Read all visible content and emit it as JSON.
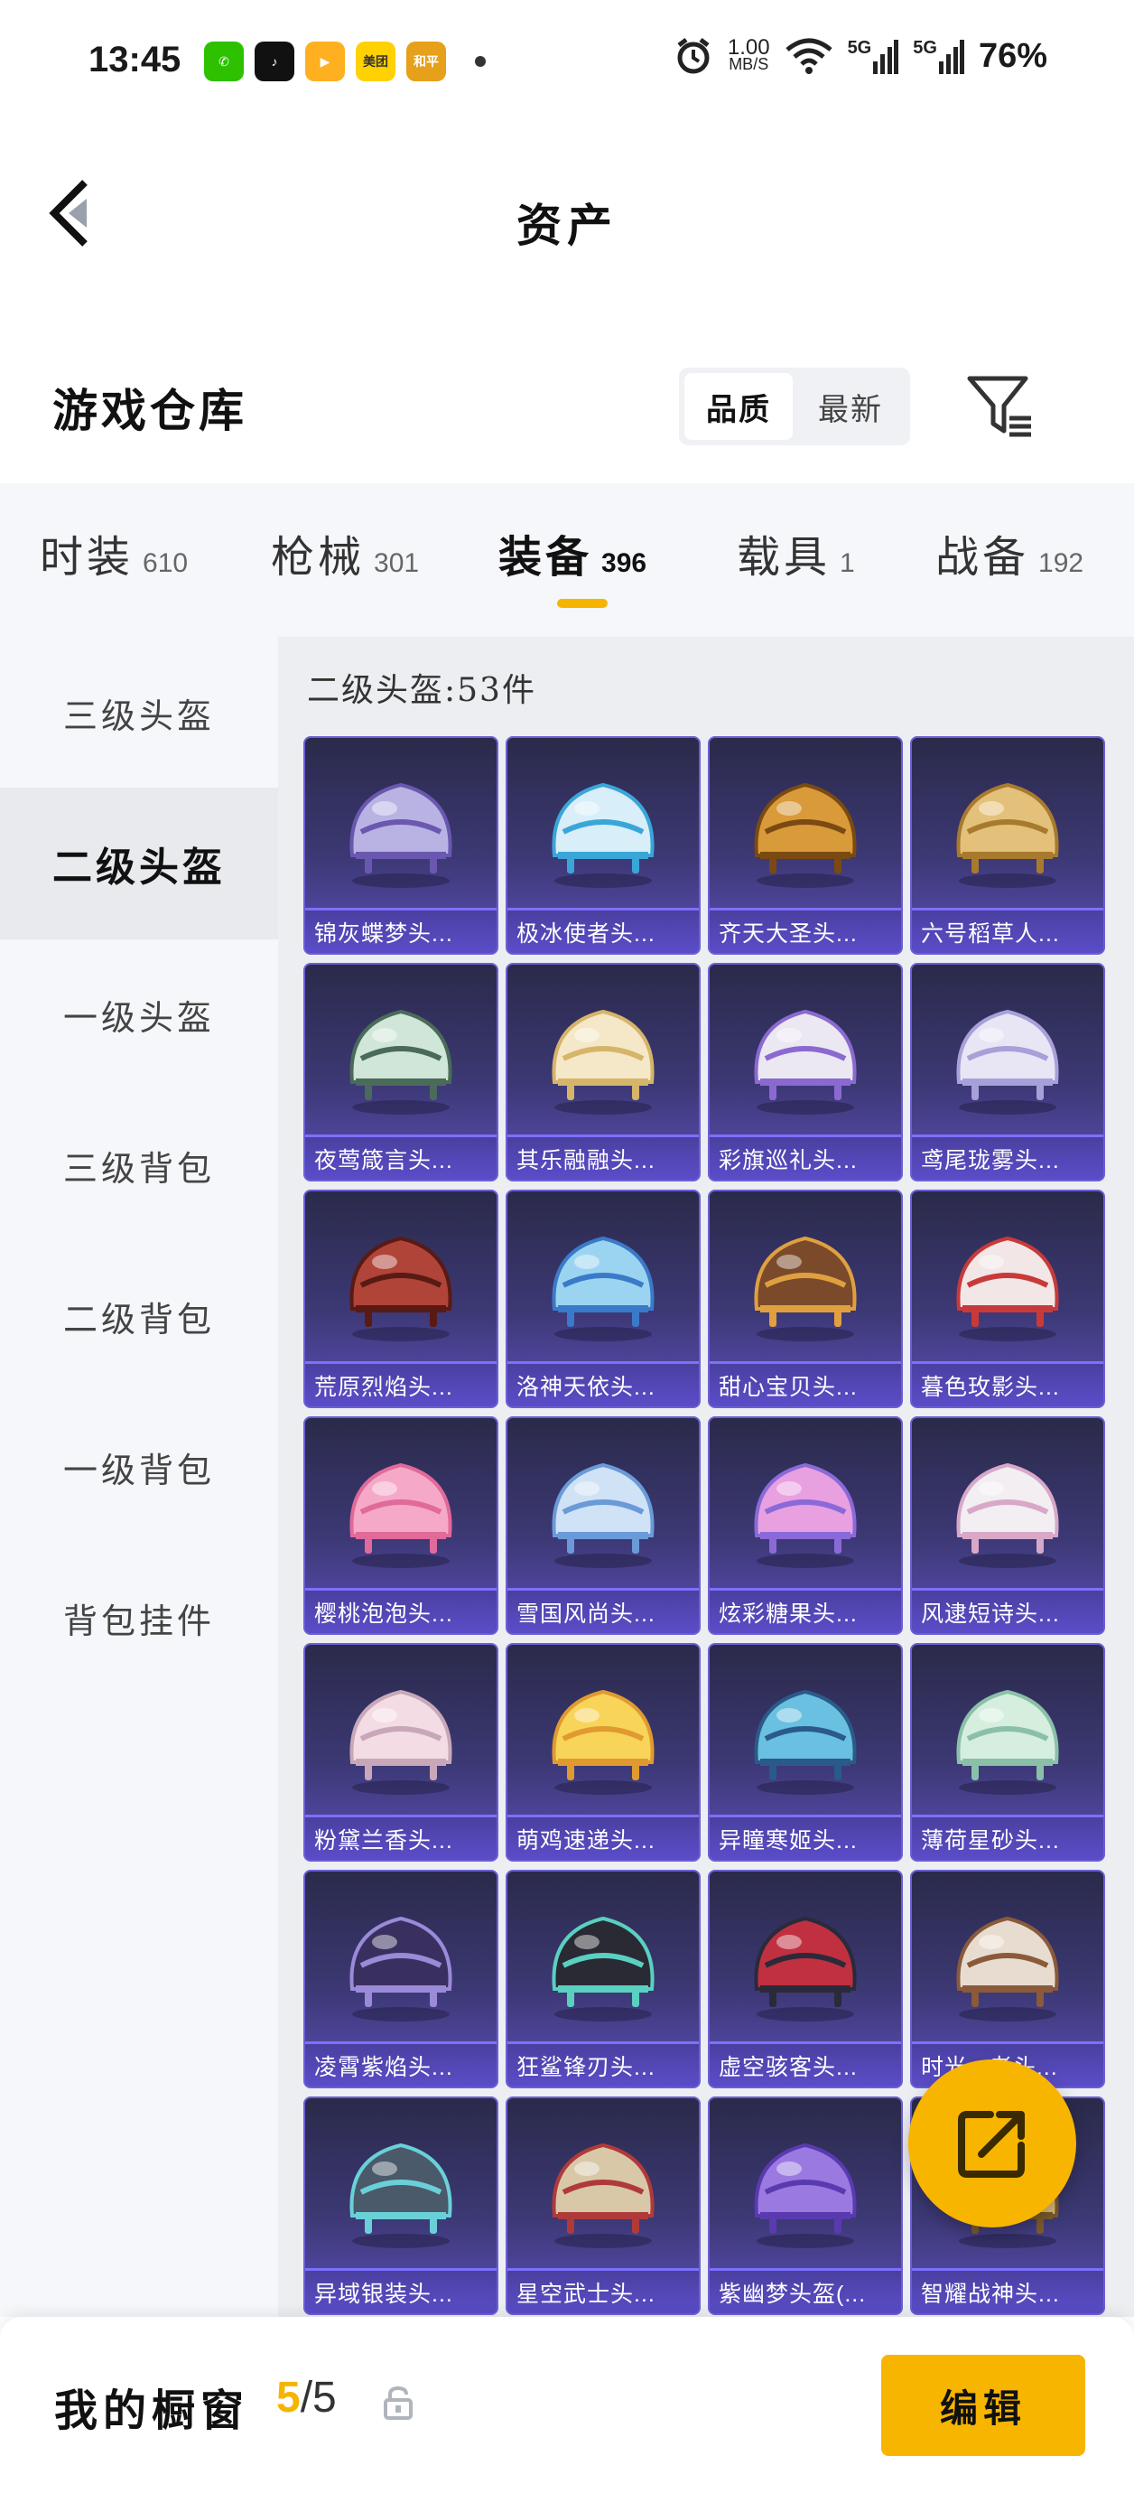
{
  "status_bar": {
    "time": "13:45",
    "apps": [
      {
        "name": "wechat-icon",
        "color": "#2dc100",
        "glyph": "✆"
      },
      {
        "name": "tiktok-icon",
        "color": "#111111",
        "glyph": "♪"
      },
      {
        "name": "video-app-icon",
        "color": "#ffb020",
        "glyph": "▶"
      },
      {
        "name": "meituan-icon",
        "color": "#ffd100",
        "glyph": "美团"
      },
      {
        "name": "game-app-icon",
        "color": "#e6a019",
        "glyph": "和平"
      }
    ],
    "net_speed_value": "1.00",
    "net_speed_unit": "MB/S",
    "network_1": "5G",
    "network_2": "5G",
    "battery": "76%"
  },
  "header": {
    "title": "资产"
  },
  "section": {
    "title": "游戏仓库",
    "sort_options": [
      "品质",
      "最新"
    ],
    "sort_active": 0
  },
  "tabs": [
    {
      "label": "时装",
      "count": "610"
    },
    {
      "label": "枪械",
      "count": "301"
    },
    {
      "label": "装备",
      "count": "396"
    },
    {
      "label": "载具",
      "count": "1"
    },
    {
      "label": "战备",
      "count": "192"
    }
  ],
  "active_tab": 2,
  "sidenav": {
    "items": [
      "三级头盔",
      "二级头盔",
      "一级头盔",
      "三级背包",
      "二级背包",
      "一级背包",
      "背包挂件"
    ],
    "active": 1
  },
  "grid": {
    "count_label": "二级头盔:53件",
    "items": [
      {
        "label": "锦灰蝶梦头...",
        "color": "#b9b3e3",
        "accent": "#6a58b0"
      },
      {
        "label": "极冰使者头...",
        "color": "#d8eef8",
        "accent": "#3aa6d8"
      },
      {
        "label": "齐天大圣头...",
        "color": "#d99a3a",
        "accent": "#7a4a12"
      },
      {
        "label": "六号稻草人...",
        "color": "#e3c17a",
        "accent": "#a77a2e"
      },
      {
        "label": "夜莺箴言头...",
        "color": "#cfe6d8",
        "accent": "#4a6a5a"
      },
      {
        "label": "其乐融融头...",
        "color": "#f4e8c8",
        "accent": "#d6b46a"
      },
      {
        "label": "彩旗巡礼头...",
        "color": "#ece8f2",
        "accent": "#8a6ad0"
      },
      {
        "label": "鸢尾珑雾头...",
        "color": "#e8e6f4",
        "accent": "#a8a0d8"
      },
      {
        "label": "荒原烈焰头...",
        "color": "#b04438",
        "accent": "#5a1a14"
      },
      {
        "label": "洛神天依头...",
        "color": "#9bd4f0",
        "accent": "#3a7ac8"
      },
      {
        "label": "甜心宝贝头...",
        "color": "#7a4a2a",
        "accent": "#e0a040"
      },
      {
        "label": "暮色玫影头...",
        "color": "#f2e6e6",
        "accent": "#c83a3a"
      },
      {
        "label": "樱桃泡泡头...",
        "color": "#f6a8c8",
        "accent": "#e06a9a"
      },
      {
        "label": "雪国风尚头...",
        "color": "#cfe2f6",
        "accent": "#6a9ad8"
      },
      {
        "label": "炫彩糖果头...",
        "color": "#e8a0e0",
        "accent": "#8a6ad8"
      },
      {
        "label": "风逮短诗头...",
        "color": "#f2eef2",
        "accent": "#d8a8c8"
      },
      {
        "label": "粉黛兰香头...",
        "color": "#f4dce4",
        "accent": "#c8a8b8"
      },
      {
        "label": "萌鸡速递头...",
        "color": "#f8d458",
        "accent": "#e09a30"
      },
      {
        "label": "异瞳寒姬头...",
        "color": "#6ac0e0",
        "accent": "#2a5a8a"
      },
      {
        "label": "薄荷星砂头...",
        "color": "#d6eede",
        "accent": "#8ac0a8"
      },
      {
        "label": "凌霄紫焰头...",
        "color": "#3a3060",
        "accent": "#9a8ad8"
      },
      {
        "label": "狂鲨锋刃头...",
        "color": "#2a2a34",
        "accent": "#5ad0c0"
      },
      {
        "label": "虚空骇客头...",
        "color": "#c03040",
        "accent": "#2a2a3a"
      },
      {
        "label": "时光...者头...",
        "color": "#e8dcd0",
        "accent": "#8a5a3a"
      },
      {
        "label": "异域银装头...",
        "color": "#4a5a6a",
        "accent": "#6ad0d8"
      },
      {
        "label": "星空武士头...",
        "color": "#d8c8a8",
        "accent": "#b03a3a"
      },
      {
        "label": "紫幽梦头盔(...",
        "color": "#9a7ae0",
        "accent": "#5a3ab0"
      },
      {
        "label": "智耀战神头...",
        "color": "#d8b878",
        "accent": "#7a5a2a"
      }
    ]
  },
  "bottom_bar": {
    "title": "我的橱窗",
    "count_current": "5",
    "count_total": "/5",
    "edit_label": "编辑"
  }
}
